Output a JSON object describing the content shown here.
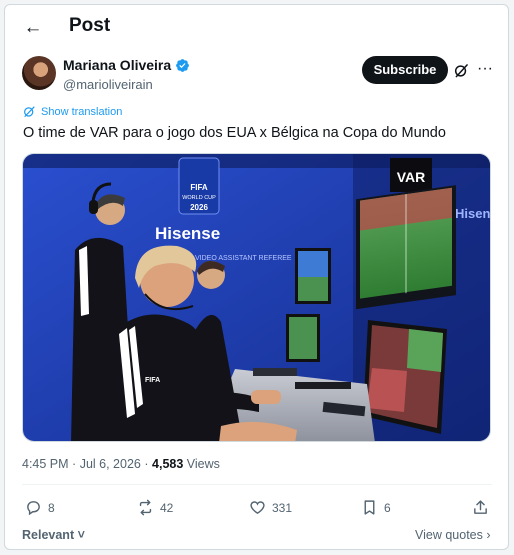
{
  "header": {
    "back_icon": "arrow-left-icon",
    "title": "Post"
  },
  "author": {
    "name": "Mariana Oliveira",
    "handle": "@marioliveirain",
    "verified_color": "#1d9bf0"
  },
  "subscribe_label": "Subscribe",
  "translate_label": "Show translation",
  "post_text": "O time de VAR para o jogo dos EUA x Bélgica na Copa do Mundo",
  "image": {
    "kind": "photo",
    "wall_text": {
      "fifa": "FIFA",
      "world_cup": "WORLD CUP",
      "year": "2026",
      "sponsor": "Hisense",
      "review": "VIDEO ASSISTANT REFEREE",
      "var_sign": "VAR",
      "sponsor_right": "Hisense",
      "shirt_crest": "FIFA"
    }
  },
  "meta": {
    "time": "4:45 PM",
    "date": "Jul 6, 2026",
    "separator": "·",
    "views_count": "4,583",
    "views_label": "Views"
  },
  "actions": {
    "replies": "8",
    "reposts": "42",
    "likes": "331",
    "bookmarks": "6"
  },
  "footer": {
    "sort_label": "Relevant",
    "view_quotes": "View quotes"
  },
  "colors": {
    "accent": "#1d9bf0",
    "text": "#0f1419",
    "muted": "#536471",
    "studio_blue": "#1f3fb0"
  }
}
